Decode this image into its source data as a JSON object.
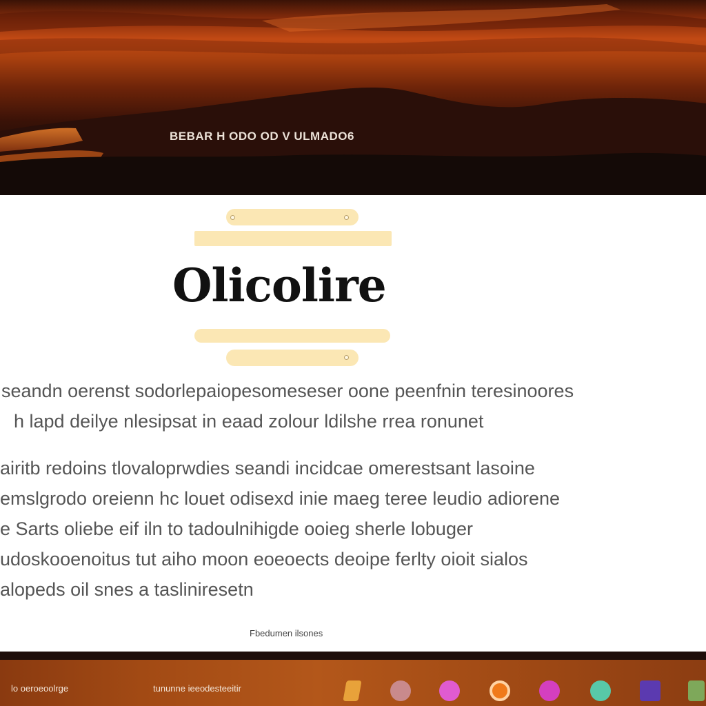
{
  "hero": {
    "caption": "BEBAR H ODO OD V ULMADO6",
    "colors": {
      "sky_top": "#3a1206",
      "sky_glow": "#c24a14",
      "mountains": "#1c0c08"
    }
  },
  "article": {
    "title": "Olicolire",
    "paragraph_1": [
      "seandn oerenst sodorlepaiopesomeseser oone peenfnin teresinoores",
      "h lapd deilye nlesipsat in eaad zolour ldilshe rrea ronunet"
    ],
    "paragraph_2": [
      "airitb redoins tlovaloprwdies seandi incidcae omerestsant lasoine",
      "emslgrodo oreienn hc louet odisexd inie maeg teree leudio adiorene",
      "e Sarts oliebe eif iln to tadoulnihigde ooieg sherle lobuger",
      "udoskooenoitus tut aiho moon eoeoects deoipe ferlty oioit sialos",
      "alopeds oil snes a tasliniresetn"
    ],
    "footnote": "Fbedumen ilsones",
    "accent_color": "#fbe7b4"
  },
  "taskbar": {
    "left_text": "lo oeroeoolrge",
    "middle_text": "tununne ieeodesteeitir",
    "dock": [
      {
        "icon": "diamond-app-icon",
        "color": "#e8a23a"
      },
      {
        "icon": "rose-circle-app-icon",
        "color": "#c98a8c"
      },
      {
        "icon": "magenta-circle-app-icon",
        "color": "#e05bd0"
      },
      {
        "icon": "orange-ring-app-icon",
        "color": "#f07a1a"
      },
      {
        "icon": "pink-circle-app-icon",
        "color": "#d43fbf"
      },
      {
        "icon": "teal-circle-app-icon",
        "color": "#58c8a8"
      },
      {
        "icon": "purple-square-app-icon",
        "color": "#5b3ab0"
      },
      {
        "icon": "green-square-app-icon",
        "color": "#7ea85a"
      }
    ]
  }
}
